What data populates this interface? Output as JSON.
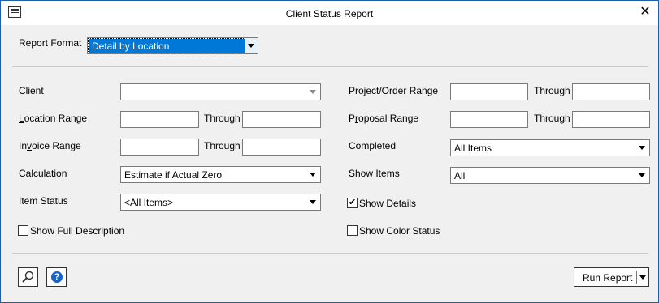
{
  "window": {
    "title": "Client Status Report",
    "close_symbol": "✕"
  },
  "report_format": {
    "label": "Report Format",
    "value": "Detail by Location"
  },
  "left": {
    "client": {
      "label": "Client",
      "value": ""
    },
    "location_range": {
      "label_pre": "",
      "label_u": "L",
      "label_post": "ocation Range",
      "through": "Through"
    },
    "invoice_range": {
      "label_pre": "In",
      "label_u": "v",
      "label_post": "oice Range",
      "through": "Through"
    },
    "calculation": {
      "label": "Calculation",
      "value": "Estimate if Actual Zero"
    },
    "item_status": {
      "label": "Item Status",
      "value": "<All Items>"
    },
    "show_full_description": {
      "label": "Show Full Description",
      "checked": false
    }
  },
  "right": {
    "project_order_range": {
      "label": "Project/Order Range",
      "through": "Through"
    },
    "proposal_range": {
      "label_pre": "P",
      "label_u": "r",
      "label_post": "oposal Range",
      "through": "Through"
    },
    "completed": {
      "label": "Completed",
      "value": "All Items"
    },
    "show_items": {
      "label": "Show Items",
      "value": "All"
    },
    "show_details": {
      "label": "Show Details",
      "checked": true
    },
    "show_color_status": {
      "label": "Show Color Status",
      "checked": false
    }
  },
  "footer": {
    "run_report": "Run Report",
    "help_symbol": "?"
  },
  "colors": {
    "selection": "#0078d7",
    "help_icon": "#1b62c4",
    "window_border": "#1e5fa8"
  }
}
